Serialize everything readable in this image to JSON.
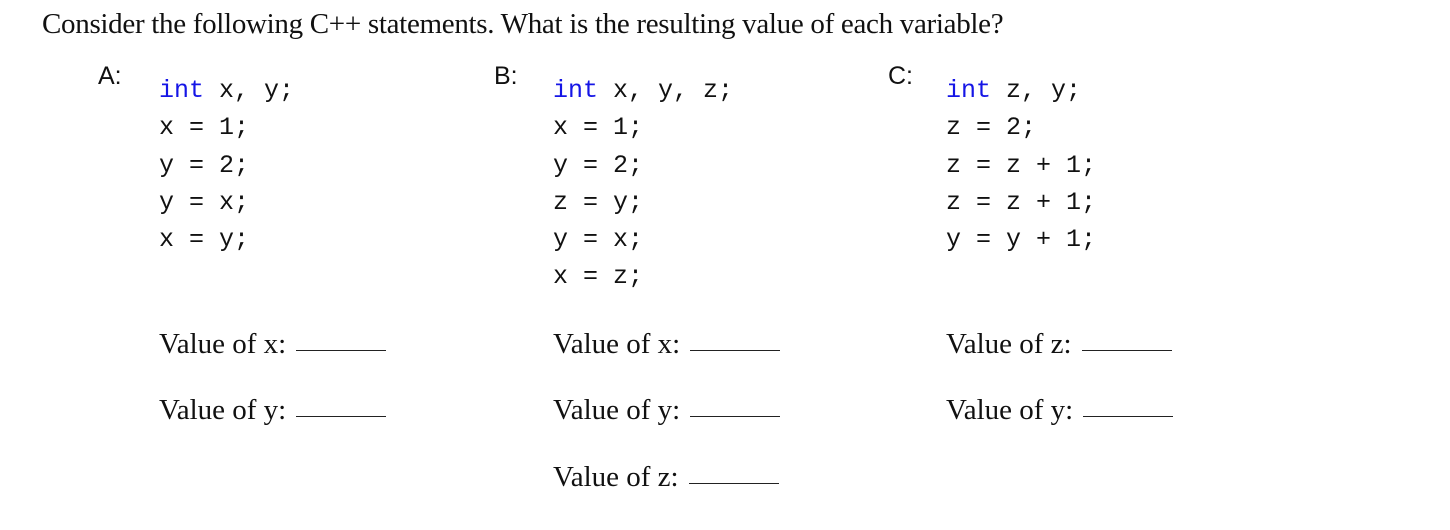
{
  "question": "Consider the following C++ statements. What is the resulting value of each variable?",
  "keyword_color": "#1515e6",
  "parts": [
    {
      "label": "A:",
      "code": [
        {
          "kw": "int",
          "rest": " x, y;"
        },
        {
          "kw": "",
          "rest": "x = 1;"
        },
        {
          "kw": "",
          "rest": "y = 2;"
        },
        {
          "kw": "",
          "rest": "y = x;"
        },
        {
          "kw": "",
          "rest": "x = y;"
        }
      ],
      "answers": [
        "Value of x:",
        "Value of y:"
      ]
    },
    {
      "label": "B:",
      "code": [
        {
          "kw": "int",
          "rest": " x, y, z;"
        },
        {
          "kw": "",
          "rest": "x = 1;"
        },
        {
          "kw": "",
          "rest": "y = 2;"
        },
        {
          "kw": "",
          "rest": "z = y;"
        },
        {
          "kw": "",
          "rest": "y = x;"
        },
        {
          "kw": "",
          "rest": "x = z;"
        }
      ],
      "answers": [
        "Value of x:",
        "Value of y:",
        "Value of z:"
      ]
    },
    {
      "label": "C:",
      "code": [
        {
          "kw": "int",
          "rest": " z, y;"
        },
        {
          "kw": "",
          "rest": "z = 2;"
        },
        {
          "kw": "",
          "rest": "z = z + 1;"
        },
        {
          "kw": "",
          "rest": "z = z + 1;"
        },
        {
          "kw": "",
          "rest": "y = y + 1;"
        }
      ],
      "answers": [
        "Value of z:",
        "Value of y:"
      ]
    }
  ]
}
